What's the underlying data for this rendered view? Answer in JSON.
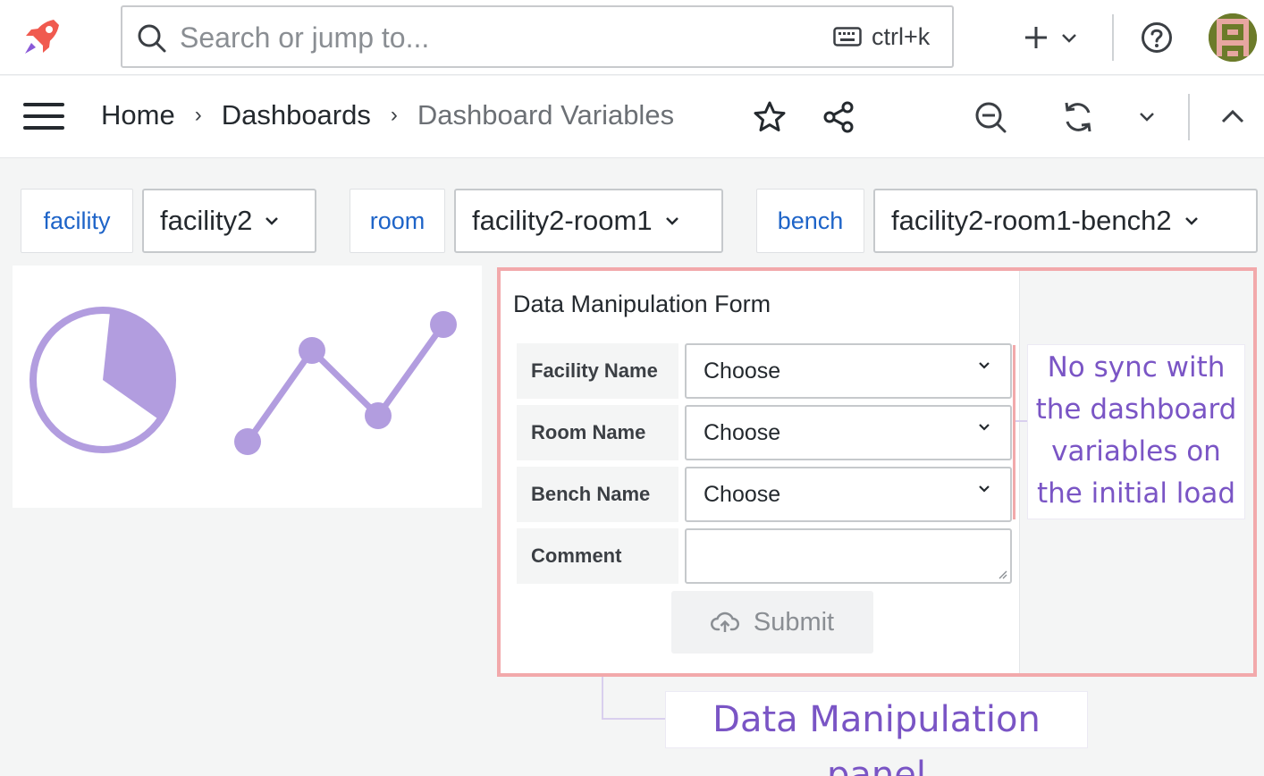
{
  "topbar": {
    "search_placeholder": "Search or jump to...",
    "shortcut": "ctrl+k",
    "icons": [
      "rocket-logo-icon",
      "search-icon",
      "keyboard-icon",
      "plus-icon",
      "chevron-down-icon",
      "help-icon",
      "avatar"
    ]
  },
  "navbar": {
    "breadcrumbs": [
      "Home",
      "Dashboards",
      "Dashboard Variables"
    ],
    "separator": "›",
    "icons": [
      "menu-icon",
      "star-icon",
      "share-icon",
      "zoom-out-icon",
      "refresh-icon",
      "chevron-down-icon",
      "chevron-up-icon"
    ]
  },
  "variables": [
    {
      "label": "facility",
      "value": "facility2"
    },
    {
      "label": "room",
      "value": "facility2-room1"
    },
    {
      "label": "bench",
      "value": "facility2-room1-bench2"
    }
  ],
  "form": {
    "title": "Data Manipulation Form",
    "fields": [
      {
        "label": "Facility Name",
        "value": "Choose"
      },
      {
        "label": "Room Name",
        "value": "Choose"
      },
      {
        "label": "Bench Name",
        "value": "Choose"
      },
      {
        "label": "Comment",
        "value": ""
      }
    ],
    "submit_label": "Submit"
  },
  "callouts": {
    "sync_note": "No sync with the dashboard variables on the initial load",
    "panel_note": "Data Manipulation panel"
  },
  "colors": {
    "accent_purple": "#b29ddf",
    "callout_text": "#7a55c5",
    "highlight_border": "#f2a9ab",
    "variable_label": "#1e64c8"
  }
}
